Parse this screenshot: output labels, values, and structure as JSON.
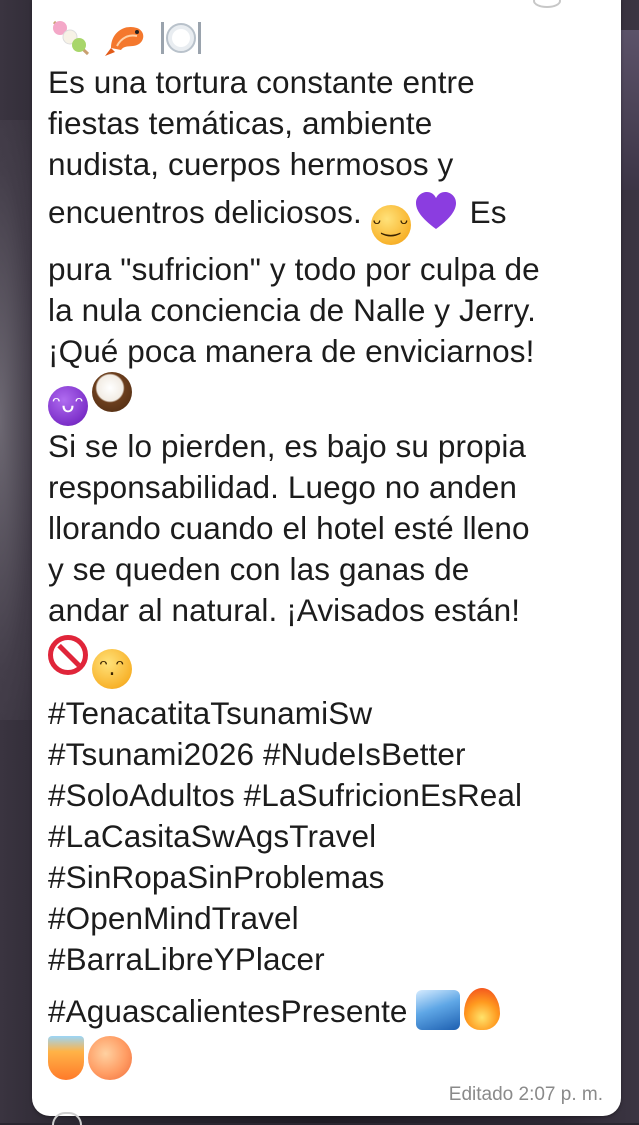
{
  "message": {
    "header_emojis": [
      "dango-icon",
      "shrimp-icon",
      "plate-cutlery-icon"
    ],
    "lines": [
      "Es una tortura constante entre",
      "fiestas temáticas, ambiente",
      "nudista, cuerpos hermosos y",
      "encuentros deliciosos.",
      "Es",
      "pura \"sufricion\" y todo por culpa de",
      "la nula conciencia de Nalle y Jerry.",
      "¡Qué poca manera de enviciarnos!",
      "Si se lo pierden, es bajo su propia",
      "responsabilidad. Luego no anden",
      "llorando cuando el hotel esté lleno",
      "y se queden con las ganas de",
      "andar al natural. ¡Avisados están!"
    ],
    "hashtags": [
      "#TenacatitaTsunamiSw",
      "#Tsunami2026 #NudeIsBetter",
      "#SoloAdultos #LaSufricionEsReal",
      "#LaCasitaSwAgsTravel",
      "#SinRopaSinProblemas",
      "#OpenMindTravel",
      "#BarraLibreYPlacer",
      "#AguascalientesPresente"
    ],
    "timestamp": "Editado 2:07 p. m."
  },
  "colors": {
    "bubble": "#ffffff",
    "text": "#1c1c1c",
    "meta": "#8a8a8a",
    "background": "#2a2630"
  }
}
